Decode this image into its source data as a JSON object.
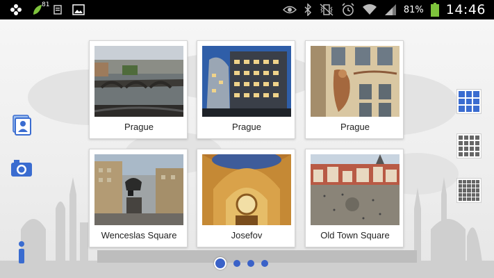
{
  "status_bar": {
    "left_icons": [
      "puzzle-icon",
      "leaf-icon",
      "storage-icon",
      "gallery-icon"
    ],
    "leaf_badge": "81",
    "right_icons": [
      "eye-icon",
      "bluetooth-icon",
      "vibrate-icon",
      "alarm-icon",
      "wifi-icon",
      "signal-icon"
    ],
    "battery_percent": "81%",
    "battery_level": 0.81,
    "time": "14:46"
  },
  "left_tools": [
    {
      "icon": "contacts-photo-icon"
    },
    {
      "icon": "camera-icon"
    },
    {
      "icon": "info-icon"
    }
  ],
  "view_options": [
    {
      "icon": "grid-3x3-icon",
      "active": true
    },
    {
      "icon": "grid-4x4-icon",
      "active": false
    },
    {
      "icon": "grid-5x5-icon",
      "active": false
    }
  ],
  "gallery": [
    {
      "caption": "Prague"
    },
    {
      "caption": "Prague"
    },
    {
      "caption": "Prague"
    },
    {
      "caption": "Wenceslas Square"
    },
    {
      "caption": "Josefov"
    },
    {
      "caption": "Old Town Square"
    }
  ],
  "pagination": {
    "pages": 4,
    "current": 1
  },
  "colors": {
    "accent": "#3a6cd0",
    "status_bar": "#000000",
    "battery": "#7ec43c"
  }
}
